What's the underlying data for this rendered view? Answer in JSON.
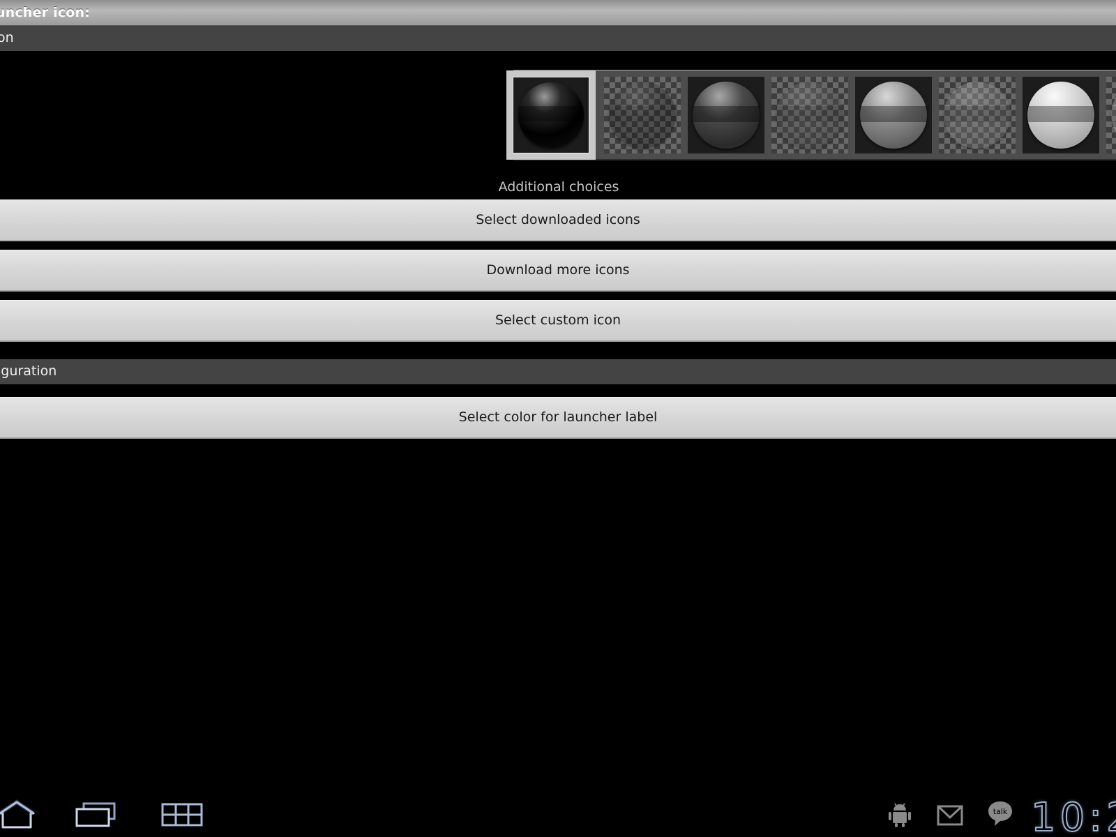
{
  "header": {
    "title": "uncher icon:"
  },
  "sections": {
    "icon": {
      "label": "on"
    },
    "configuration": {
      "label": "iguration"
    }
  },
  "icon_strip": {
    "icons": [
      {
        "name": "orb-black",
        "style": "black",
        "selected": true,
        "checkered": false
      },
      {
        "name": "orb-black-transparent",
        "style": "black",
        "selected": false,
        "checkered": true
      },
      {
        "name": "orb-dark-gray",
        "style": "darkgray",
        "selected": false,
        "checkered": false
      },
      {
        "name": "orb-dark-gray-transparent",
        "style": "darkgray",
        "selected": false,
        "checkered": true
      },
      {
        "name": "orb-gray",
        "style": "gray",
        "selected": false,
        "checkered": false
      },
      {
        "name": "orb-gray-transparent",
        "style": "gray",
        "selected": false,
        "checkered": true
      },
      {
        "name": "orb-light-gray",
        "style": "lightgray",
        "selected": false,
        "checkered": false
      },
      {
        "name": "orb-partial",
        "style": "lightgray",
        "selected": false,
        "checkered": true
      }
    ]
  },
  "additional": {
    "label": "Additional choices",
    "select_downloaded": "Select downloaded icons",
    "download_more": "Download more icons",
    "select_custom": "Select custom icon"
  },
  "config": {
    "select_color": "Select color for launcher label"
  },
  "navigation": {
    "icons": [
      "home-icon",
      "recent-apps-icon",
      "menu-grid-icon"
    ]
  },
  "status": {
    "icons": [
      "android-debug-icon",
      "gmail-icon",
      "talk-icon"
    ],
    "clock": "10:2",
    "talk_badge": "talk"
  },
  "colors": {
    "button_bg": "#d6d6d6",
    "section_bg": "#444444",
    "nav_glow": "#9fb0c8"
  }
}
